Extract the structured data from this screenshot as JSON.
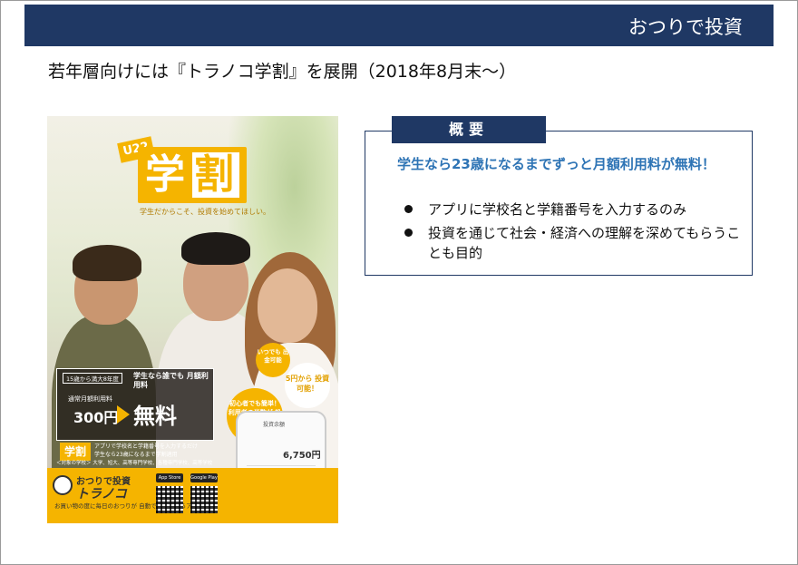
{
  "header": {
    "title": "おつりで投資"
  },
  "subtitle": "若年層向けには『トラノコ学割』を展開（2018年8月末～）",
  "poster": {
    "u22": "U22",
    "gaku": "学",
    "wari": "割",
    "tagline": "学生だからこそ、投資を始めてほしい。",
    "eligibility_label": "15歳から満大8年度",
    "note": "学生なら誰でも 月額利用料",
    "usual_label": "通常月額利用料",
    "usual_price": "300円",
    "free": "無料",
    "gaku_small": "学割",
    "gaku_text_1": "アプリで学校名と学籍番号を入力するだけ",
    "gaku_text_2": "学生なら23歳になるまで学割適用",
    "target": "＜対象の学校＞ 大学、短大、高等専門学校、各種専門学校、高等学校",
    "badge1": "いつでも 出金可能",
    "badge2": "5円から 投資可能！",
    "badge3": "初心者でも簡単！ 利用者の半数が 投資未経験者",
    "phone_title": "投資余額",
    "phone_amount": "6,750円",
    "logo_text": "おつりで投資",
    "logo_brand": "トラノコ",
    "footer_desc": "お買い物の度に毎日のおつりが 自動で投資に回るアプリ",
    "store1": "App Store",
    "store2": "Google Play"
  },
  "summary": {
    "tab_label": "概要",
    "lead": "学生なら23歳になるまでずっと月額利用料が無料！",
    "bullets": [
      "アプリに学校名と学籍番号を入力するのみ",
      "投資を通じて社会・経済への理解を深めてもらうことも目的"
    ]
  }
}
